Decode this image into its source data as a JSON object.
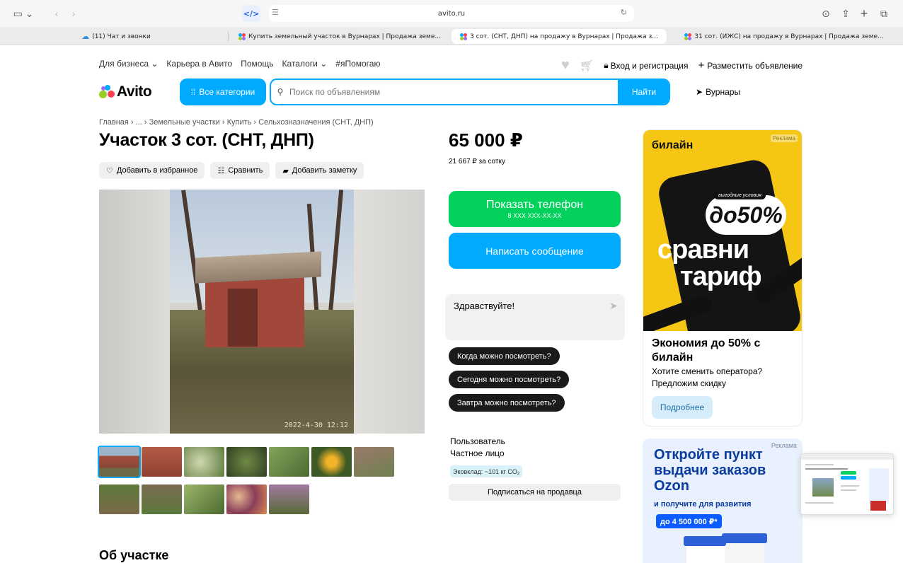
{
  "browser": {
    "url": "avito.ru",
    "tabs": [
      {
        "label": "(11) Чат и звонки",
        "active": false
      },
      {
        "label": "Купить земельный участок в Вурнарах | Продажа земе...",
        "active": false
      },
      {
        "label": "3 сот. (СНТ, ДНП) на продажу в Вурнарах | Продажа з...",
        "active": true
      },
      {
        "label": "31 сот. (ИЖС) на продажу в Вурнарах | Продажа земе...",
        "active": false
      }
    ]
  },
  "header": {
    "links": [
      "Для бизнеса ⌄",
      "Карьера в Авито",
      "Помощь",
      "Каталоги ⌄",
      "#яПомогаю"
    ],
    "login": "Вход и регистрация",
    "post_ad": "Разместить объявление",
    "logo": "Avito",
    "categories": "Все категории",
    "search_placeholder": "Поиск по объявлениям",
    "search_button": "Найти",
    "location": "Вурнары"
  },
  "listing": {
    "breadcrumb": "Главная › ... › Земельные участки › Купить › Сельхозназначения (СНТ, ДНП)",
    "title": "Участок 3 сот. (СНТ, ДНП)",
    "actions": {
      "favorite": "Добавить в избранное",
      "compare": "Сравнить",
      "note": "Добавить заметку"
    },
    "photo_timestamp": "2022-4-30 12:12",
    "about_heading": "Об участке"
  },
  "sidebar": {
    "price": "65 000 ₽",
    "price_per_unit": "21 667 ₽ за сотку",
    "show_phone": "Показать телефон",
    "phone_mask": "8 XXX XXX-XX-XX",
    "write_message": "Написать сообщение",
    "message_text": "Здравствуйте!",
    "quick_questions": [
      "Когда можно посмотреть?",
      "Сегодня можно посмотреть?",
      "Завтра можно посмотреть?"
    ],
    "seller_role": "Пользователь",
    "seller_type": "Частное лицо",
    "eco": "Эковклад: ~101 кг CO₂",
    "subscribe": "Подписаться на продавца"
  },
  "ads": {
    "beeline": {
      "brand": "билайн",
      "label": "Реклама",
      "tag": "выгодные условия",
      "discount": "до50%",
      "slogan1": "сравни",
      "slogan2": "тариф",
      "heading": "Экономия до 50% с билайн",
      "text": "Хотите сменить оператора? Предложим скидку",
      "button": "Подробнее"
    },
    "ozon": {
      "label": "Реклама",
      "heading": "Откройте пункт выдачи заказов Ozon",
      "text": "и получите для развития",
      "badge": "до 4 500 000 ₽*"
    }
  },
  "colors": {
    "accent": "#00aaff",
    "green": "#02d15c",
    "beeline_yellow": "#f6c614",
    "ozon_blue": "#0a3b9e"
  }
}
